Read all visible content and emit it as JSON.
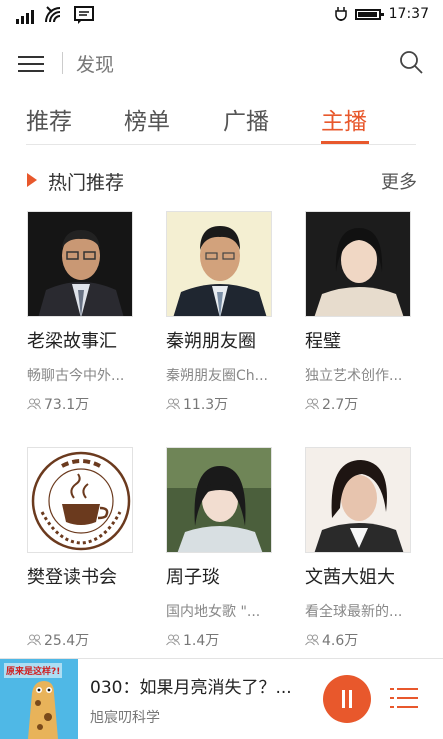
{
  "statusbar": {
    "time": "17:37"
  },
  "topbar": {
    "title": "发现"
  },
  "tabs": [
    {
      "label": "推荐"
    },
    {
      "label": "榜单"
    },
    {
      "label": "广播"
    },
    {
      "label": "主播"
    }
  ],
  "active_tab": "主播",
  "section": {
    "title": "热门推荐",
    "more": "更多"
  },
  "cards": [
    {
      "name": "老梁故事汇",
      "desc": "畅聊古今中外...",
      "fans": "73.1万"
    },
    {
      "name": "秦朔朋友圈",
      "desc": "秦朔朋友圈Ch...",
      "fans": "11.3万"
    },
    {
      "name": "程璧",
      "desc": "独立艺术创作...",
      "fans": "2.7万"
    },
    {
      "name": "樊登读书会",
      "desc": "",
      "fans": "25.4万"
    },
    {
      "name": "周子琰",
      "desc": "国内地女歌 \"...",
      "fans": "1.4万"
    },
    {
      "name": "文茜大姐大",
      "desc": "看全球最新的...",
      "fans": "4.6万"
    }
  ],
  "logo_text": {
    "top": "樊登读书会",
    "ring": "SPIRITUAL WEALTH CLUB"
  },
  "player": {
    "cover_text": "原来是这样?!",
    "title": "030：如果月亮消失了？...",
    "subtitle": "旭宸叨科学"
  },
  "colors": {
    "accent": "#e8582c"
  }
}
